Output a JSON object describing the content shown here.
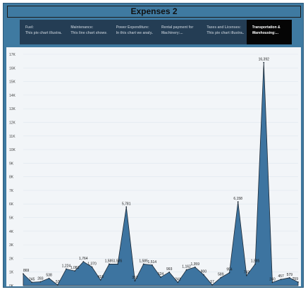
{
  "title": "Expenses 2",
  "tabs": [
    {
      "line1": "Fuel:",
      "line2": "This pie chart illustra..."
    },
    {
      "line1": "Maintenance:",
      "line2": "This line chart shows ..."
    },
    {
      "line1": "Power Expenditure:",
      "line2": "In this chart we analy..."
    },
    {
      "line1": "Rental payment for",
      "line2": "Machinery:..."
    },
    {
      "line1": "Taxes and Licenses:",
      "line2": "This pie chart illustra..."
    },
    {
      "line1": "Transportation &",
      "line2": "Warehousing:..."
    }
  ],
  "active_tab": 5,
  "colors": {
    "area_fill": "#3d74a0",
    "area_stroke": "#1e2a36",
    "grid": "#dfe6ee"
  },
  "chart_data": {
    "type": "area",
    "title": "",
    "xlabel": "",
    "ylabel": "",
    "ylim": [
      0,
      17000
    ],
    "yticks": [
      0,
      1000,
      2000,
      3000,
      4000,
      5000,
      6000,
      7000,
      8000,
      9000,
      10000,
      11000,
      12000,
      13000,
      14000,
      15000,
      16000,
      17000
    ],
    "ytick_labels": [
      "0K",
      "1K",
      "2K",
      "3K",
      "4K",
      "5K",
      "6K",
      "7K",
      "8K",
      "9K",
      "10K",
      "11K",
      "12K",
      "13K",
      "14K",
      "15K",
      "16K",
      "17K"
    ],
    "values": [
      869,
      245,
      283,
      538,
      57,
      1224,
      1081,
      1764,
      1370,
      418,
      1585,
      1585,
      5781,
      352,
      1585,
      1514,
      624,
      993,
      241,
      1162,
      1359,
      800,
      57,
      589,
      954,
      6158,
      742,
      1585,
      16392,
      240,
      457,
      579,
      259
    ],
    "labels": [
      "869",
      "245",
      "283",
      "538",
      "57",
      "1,224",
      "1,081",
      "1,764",
      "1,370",
      "418",
      "1,585",
      "1,585",
      "5,781",
      "352",
      "1,585",
      "1,514",
      "624",
      "993",
      "241",
      "1,162",
      "1,359",
      "800",
      "57",
      "589",
      "954",
      "6,158",
      "742",
      "1,585",
      "16,392",
      "240",
      "457",
      "579",
      "259"
    ],
    "grid": true
  }
}
